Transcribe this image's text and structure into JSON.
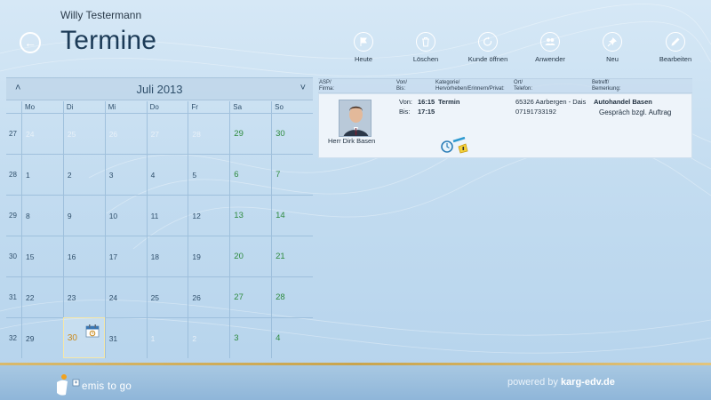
{
  "header": {
    "user_name": "Willy Testermann",
    "title": "Termine",
    "back_label": "←"
  },
  "toolbar": [
    {
      "label": "Heute",
      "icon": "flag-icon"
    },
    {
      "label": "Löschen",
      "icon": "trash-icon"
    },
    {
      "label": "Kunde öffnen",
      "icon": "open-customer-icon"
    },
    {
      "label": "Anwender",
      "icon": "users-icon"
    },
    {
      "label": "Neu",
      "icon": "pin-icon"
    },
    {
      "label": "Bearbeiten",
      "icon": "pencil-icon"
    }
  ],
  "calendar": {
    "month_label": "Juli 2013",
    "prev_label": "˄",
    "next_label": "˅",
    "weekdays": [
      "Mo",
      "Di",
      "Mi",
      "Do",
      "Fr",
      "Sa",
      "So"
    ],
    "weeks": [
      {
        "num": "27",
        "days": [
          {
            "d": "24",
            "o": true
          },
          {
            "d": "25",
            "o": true
          },
          {
            "d": "26",
            "o": true
          },
          {
            "d": "27",
            "o": true
          },
          {
            "d": "28",
            "o": true
          },
          {
            "d": "29"
          },
          {
            "d": "30"
          }
        ]
      },
      {
        "num": "28",
        "days": [
          {
            "d": "1"
          },
          {
            "d": "2"
          },
          {
            "d": "3"
          },
          {
            "d": "4"
          },
          {
            "d": "5"
          },
          {
            "d": "6"
          },
          {
            "d": "7"
          }
        ]
      },
      {
        "num": "29",
        "days": [
          {
            "d": "8"
          },
          {
            "d": "9"
          },
          {
            "d": "10"
          },
          {
            "d": "11"
          },
          {
            "d": "12"
          },
          {
            "d": "13"
          },
          {
            "d": "14"
          }
        ]
      },
      {
        "num": "30",
        "days": [
          {
            "d": "15"
          },
          {
            "d": "16"
          },
          {
            "d": "17"
          },
          {
            "d": "18"
          },
          {
            "d": "19"
          },
          {
            "d": "20"
          },
          {
            "d": "21"
          }
        ]
      },
      {
        "num": "31",
        "days": [
          {
            "d": "22"
          },
          {
            "d": "23"
          },
          {
            "d": "24"
          },
          {
            "d": "25"
          },
          {
            "d": "26"
          },
          {
            "d": "27"
          },
          {
            "d": "28"
          }
        ]
      },
      {
        "num": "32",
        "days": [
          {
            "d": "29"
          },
          {
            "d": "30",
            "today": true
          },
          {
            "d": "31"
          },
          {
            "d": "1",
            "o": true
          },
          {
            "d": "2",
            "o": true
          },
          {
            "d": "3"
          },
          {
            "d": "4"
          }
        ]
      }
    ]
  },
  "list_header": {
    "col1_l1": "ASP/",
    "col1_l2": "Firma:",
    "col2_l1": "Von/",
    "col2_l2": "Bis:",
    "col3_l1": "Kategorie/",
    "col3_l2": "Hervorheben/Erinnern/Privat:",
    "col4_l1": "Ort/",
    "col4_l2": "Telefon:",
    "col5_l1": "Betreff/",
    "col5_l2": "Bemerkung:"
  },
  "appointment": {
    "person": "Herr Dirk Basen",
    "von_label": "Von:",
    "von_time": "16:15",
    "bis_label": "Bis:",
    "bis_time": "17:15",
    "category": "Termin",
    "location": "65326 Aarbergen - Dais",
    "phone": "07191733192",
    "company": "Autohandel Basen",
    "note": "Gespräch bzgl. Auftrag"
  },
  "footer": {
    "brand": "emis to go",
    "powered_prefix": "powered by",
    "powered_domain": "karg-edv.de"
  },
  "colors": {
    "accent": "#1c3b57",
    "weekend": "#2d8a3d",
    "today": "#c98a1d",
    "gold_line": "#c9a44d"
  }
}
